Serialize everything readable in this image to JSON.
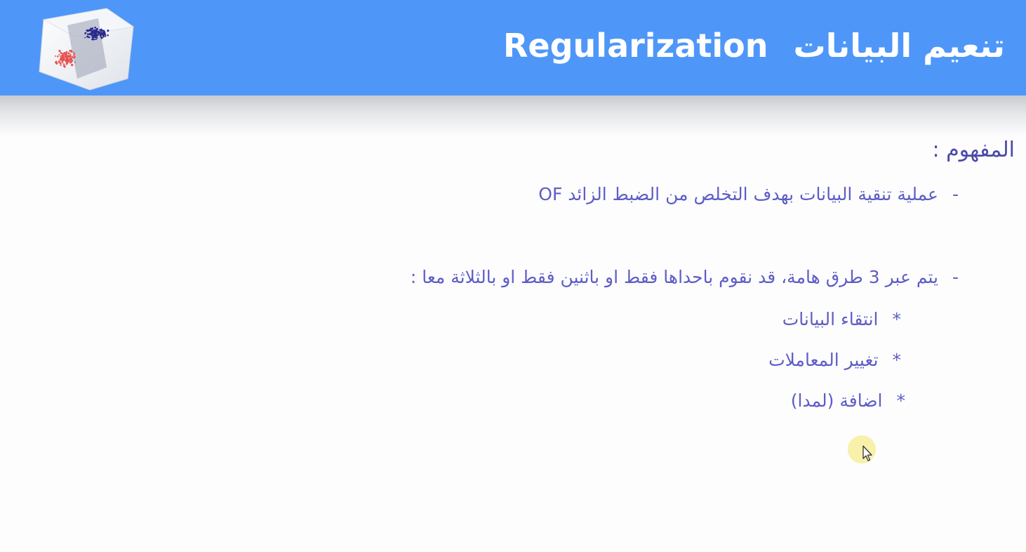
{
  "slide": {
    "title_ar": "تنعيم البيانات",
    "title_en": "Regularization",
    "concept_label": "المفهوم :",
    "dash": "-",
    "star": "*",
    "lines": [
      "عملية تنقية  البيانات بهدف التخلص من الضبط الزائد OF",
      "يتم عبر 3 طرق هامة، قد نقوم باحداها فقط او باثنين فقط او بالثلاثة  معا :"
    ],
    "bullets": [
      "انتقاء البيانات",
      "تغيير المعاملات",
      "اضافة (لمدا)"
    ]
  },
  "logo": {
    "icon": "3d-scatter-plot-icon",
    "colors": {
      "cluster_a": "#2a2a8c",
      "cluster_b": "#e85050",
      "plane": "#9aa0b4"
    }
  },
  "colors": {
    "header_bg": "#4e97f8",
    "title_text": "#ffffff",
    "body_text": "#5d5dc6",
    "cursor_highlight": "#f6ee9a"
  }
}
